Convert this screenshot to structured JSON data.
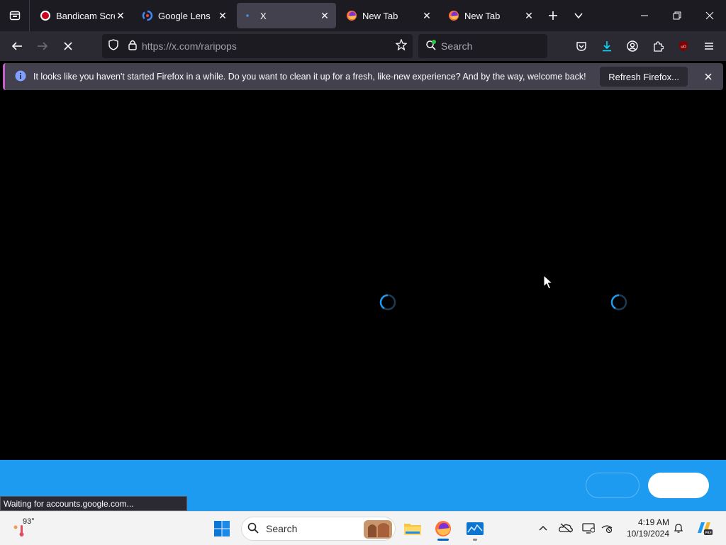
{
  "browser": {
    "tabs": [
      {
        "title": "Bandicam Scree",
        "favicon": "bandicam-record-icon",
        "active": false
      },
      {
        "title": "Google Lens",
        "favicon": "google-lens-icon",
        "active": false
      },
      {
        "title": "X",
        "favicon": "loading-dot-icon",
        "active": true
      },
      {
        "title": "New Tab",
        "favicon": "firefox-icon",
        "active": false
      },
      {
        "title": "New Tab",
        "favicon": "firefox-icon",
        "active": false
      }
    ],
    "url": "https://x.com/raripops",
    "search_placeholder": "Search",
    "notification": {
      "message": "It looks like you haven't started Firefox in a while. Do you want to clean it up for a fresh, like-new experience? And by the way, welcome back!",
      "button_label": "Refresh Firefox..."
    },
    "status_text": "Waiting for accounts.google.com...",
    "colors": {
      "toolbar": "#2b2a33",
      "tabstrip": "#1c1b22",
      "x_blue_bar": "#1d9bf0",
      "spinner": "#1d9bf0"
    }
  },
  "taskbar": {
    "weather_temp": "93°",
    "search_label": "Search",
    "time": "4:19 AM",
    "date": "10/19/2024",
    "pinned": [
      "start-icon",
      "file-explorer-icon",
      "firefox-icon",
      "photos-app-icon"
    ],
    "tray_icons": [
      "chevron-up-icon",
      "onedrive-icon",
      "display-icon",
      "network-off-icon",
      "notification-bell-icon",
      "copilot-icon"
    ]
  }
}
